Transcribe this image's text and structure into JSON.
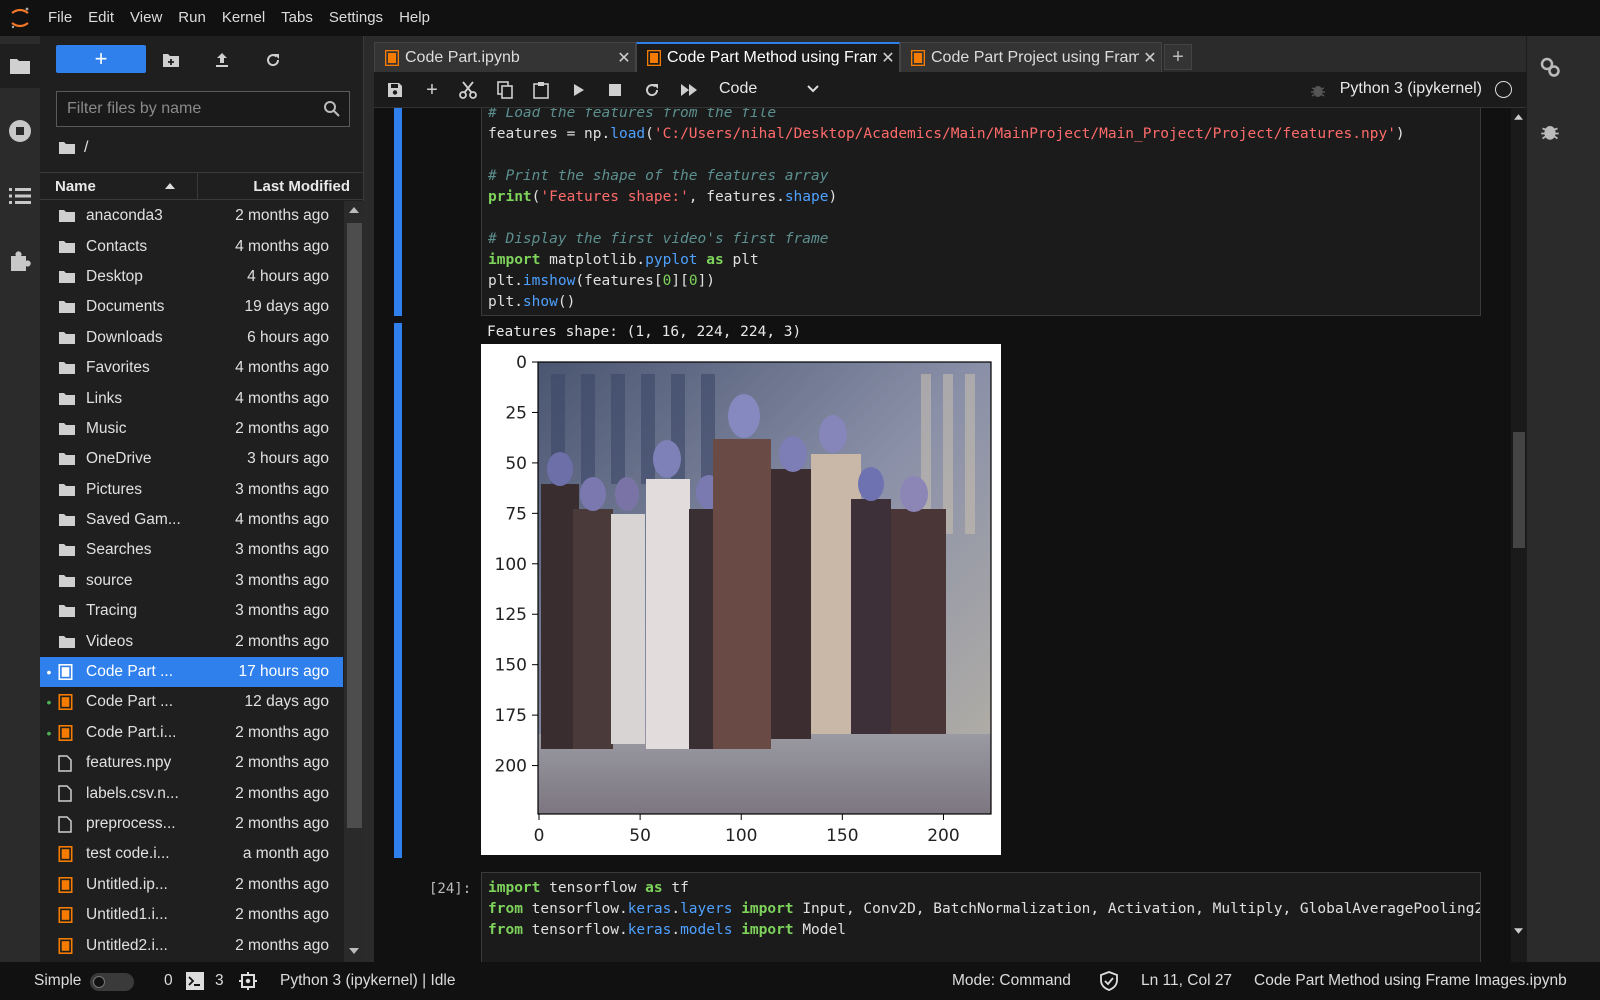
{
  "menubar": {
    "items": [
      "File",
      "Edit",
      "View",
      "Run",
      "Kernel",
      "Tabs",
      "Settings",
      "Help"
    ]
  },
  "filebrowser": {
    "new_label": "+",
    "filter_placeholder": "Filter files by name",
    "breadcrumb": "/",
    "header": {
      "name": "Name",
      "modified": "Last Modified"
    },
    "files": [
      {
        "name": "anaconda3",
        "modified": "2 months ago",
        "type": "folder",
        "running": false,
        "selected": false
      },
      {
        "name": "Contacts",
        "modified": "4 months ago",
        "type": "folder",
        "running": false,
        "selected": false
      },
      {
        "name": "Desktop",
        "modified": "4 hours ago",
        "type": "folder",
        "running": false,
        "selected": false
      },
      {
        "name": "Documents",
        "modified": "19 days ago",
        "type": "folder",
        "running": false,
        "selected": false
      },
      {
        "name": "Downloads",
        "modified": "6 hours ago",
        "type": "folder",
        "running": false,
        "selected": false
      },
      {
        "name": "Favorites",
        "modified": "4 months ago",
        "type": "folder",
        "running": false,
        "selected": false
      },
      {
        "name": "Links",
        "modified": "4 months ago",
        "type": "folder",
        "running": false,
        "selected": false
      },
      {
        "name": "Music",
        "modified": "2 months ago",
        "type": "folder",
        "running": false,
        "selected": false
      },
      {
        "name": "OneDrive",
        "modified": "3 hours ago",
        "type": "folder",
        "running": false,
        "selected": false
      },
      {
        "name": "Pictures",
        "modified": "3 months ago",
        "type": "folder",
        "running": false,
        "selected": false
      },
      {
        "name": "Saved Gam...",
        "modified": "4 months ago",
        "type": "folder",
        "running": false,
        "selected": false
      },
      {
        "name": "Searches",
        "modified": "3 months ago",
        "type": "folder",
        "running": false,
        "selected": false
      },
      {
        "name": "source",
        "modified": "3 months ago",
        "type": "folder",
        "running": false,
        "selected": false
      },
      {
        "name": "Tracing",
        "modified": "3 months ago",
        "type": "folder",
        "running": false,
        "selected": false
      },
      {
        "name": "Videos",
        "modified": "2 months ago",
        "type": "folder",
        "running": false,
        "selected": false
      },
      {
        "name": "Code Part ...",
        "modified": "17 hours ago",
        "type": "notebook",
        "running": true,
        "selected": true
      },
      {
        "name": "Code Part ...",
        "modified": "12 days ago",
        "type": "notebook",
        "running": true,
        "selected": false
      },
      {
        "name": "Code Part.i...",
        "modified": "2 months ago",
        "type": "notebook",
        "running": true,
        "selected": false
      },
      {
        "name": "features.npy",
        "modified": "2 months ago",
        "type": "file",
        "running": false,
        "selected": false
      },
      {
        "name": "labels.csv.n...",
        "modified": "2 months ago",
        "type": "file",
        "running": false,
        "selected": false
      },
      {
        "name": "preprocess...",
        "modified": "2 months ago",
        "type": "file",
        "running": false,
        "selected": false
      },
      {
        "name": "test code.i...",
        "modified": "a month ago",
        "type": "notebook",
        "running": false,
        "selected": false
      },
      {
        "name": "Untitled.ip...",
        "modified": "2 months ago",
        "type": "notebook",
        "running": false,
        "selected": false
      },
      {
        "name": "Untitled1.i...",
        "modified": "2 months ago",
        "type": "notebook",
        "running": false,
        "selected": false
      },
      {
        "name": "Untitled2.i...",
        "modified": "2 months ago",
        "type": "notebook",
        "running": false,
        "selected": false
      }
    ]
  },
  "tabs": [
    {
      "label": "Code Part.ipynb",
      "active": false
    },
    {
      "label": "Code Part Method using Fram",
      "active": true
    },
    {
      "label": "Code Part Project using Fram",
      "active": false
    }
  ],
  "tab_add": "+",
  "nbtoolbar": {
    "cell_type": "Code",
    "kernel": "Python 3 (ipykernel)"
  },
  "cells": {
    "cell1_lines": [
      [
        {
          "t": "# Load the features from the file",
          "c": "cm-comment"
        }
      ],
      [
        {
          "t": "features ",
          "c": ""
        },
        {
          "t": "=",
          "c": ""
        },
        {
          "t": " np.",
          "c": ""
        },
        {
          "t": "load",
          "c": "cm-prop"
        },
        {
          "t": "(",
          "c": ""
        },
        {
          "t": "'C:/Users/nihal/Desktop/Academics/Main/MainProject/Main_Project/Project/features.npy'",
          "c": "cm-string"
        },
        {
          "t": ")",
          "c": ""
        }
      ],
      [
        {
          "t": "",
          "c": ""
        }
      ],
      [
        {
          "t": "# Print the shape of the features array",
          "c": "cm-comment"
        }
      ],
      [
        {
          "t": "print",
          "c": "cm-keyword"
        },
        {
          "t": "(",
          "c": ""
        },
        {
          "t": "'Features shape:'",
          "c": "cm-string"
        },
        {
          "t": ", features.",
          "c": ""
        },
        {
          "t": "shape",
          "c": "cm-prop"
        },
        {
          "t": ")",
          "c": ""
        }
      ],
      [
        {
          "t": "",
          "c": ""
        }
      ],
      [
        {
          "t": "# Display the first video's first frame",
          "c": "cm-comment"
        }
      ],
      [
        {
          "t": "import",
          "c": "cm-keyword"
        },
        {
          "t": " matplotlib.",
          "c": ""
        },
        {
          "t": "pyplot",
          "c": "cm-prop"
        },
        {
          "t": " ",
          "c": ""
        },
        {
          "t": "as",
          "c": "cm-keyword"
        },
        {
          "t": " plt",
          "c": ""
        }
      ],
      [
        {
          "t": "plt.",
          "c": ""
        },
        {
          "t": "imshow",
          "c": "cm-prop"
        },
        {
          "t": "(features[",
          "c": ""
        },
        {
          "t": "0",
          "c": "cm-num"
        },
        {
          "t": "][",
          "c": ""
        },
        {
          "t": "0",
          "c": "cm-num"
        },
        {
          "t": "])",
          "c": ""
        }
      ],
      [
        {
          "t": "plt.",
          "c": ""
        },
        {
          "t": "show",
          "c": "cm-prop"
        },
        {
          "t": "()",
          "c": ""
        }
      ]
    ],
    "output_text": "Features shape: (1, 16, 224, 224, 3)",
    "cell2_prompt": "[24]:",
    "cell2_lines": [
      [
        {
          "t": "import",
          "c": "cm-keyword"
        },
        {
          "t": " tensorflow ",
          "c": ""
        },
        {
          "t": "as",
          "c": "cm-keyword"
        },
        {
          "t": " tf",
          "c": ""
        }
      ],
      [
        {
          "t": "from",
          "c": "cm-keyword"
        },
        {
          "t": " tensorflow.",
          "c": ""
        },
        {
          "t": "keras",
          "c": "cm-prop"
        },
        {
          "t": ".",
          "c": ""
        },
        {
          "t": "layers",
          "c": "cm-prop"
        },
        {
          "t": " ",
          "c": ""
        },
        {
          "t": "import",
          "c": "cm-keyword"
        },
        {
          "t": " Input, Conv2D, BatchNormalization, Activation, Multiply, GlobalAveragePooling2",
          "c": ""
        }
      ],
      [
        {
          "t": "from",
          "c": "cm-keyword"
        },
        {
          "t": " tensorflow.",
          "c": ""
        },
        {
          "t": "keras",
          "c": "cm-prop"
        },
        {
          "t": ".",
          "c": ""
        },
        {
          "t": "models",
          "c": "cm-prop"
        },
        {
          "t": " ",
          "c": ""
        },
        {
          "t": "import",
          "c": "cm-keyword"
        },
        {
          "t": " Model",
          "c": ""
        }
      ]
    ]
  },
  "plot": {
    "x_ticks": [
      "0",
      "50",
      "100",
      "150",
      "200"
    ],
    "y_ticks": [
      "0",
      "25",
      "50",
      "75",
      "100",
      "125",
      "150",
      "175",
      "200"
    ]
  },
  "statusbar": {
    "simple": "Simple",
    "terminals": "0",
    "kernels": "3",
    "kernel_status": "Python 3 (ipykernel) | Idle",
    "mode": "Mode: Command",
    "position": "Ln 11, Col 27",
    "filename": "Code Part Method using Frame Images.ipynb"
  },
  "colors": {
    "accent": "#2f80ed",
    "notebook_icon": "#f57c00",
    "running_dot": "#4caf50"
  }
}
